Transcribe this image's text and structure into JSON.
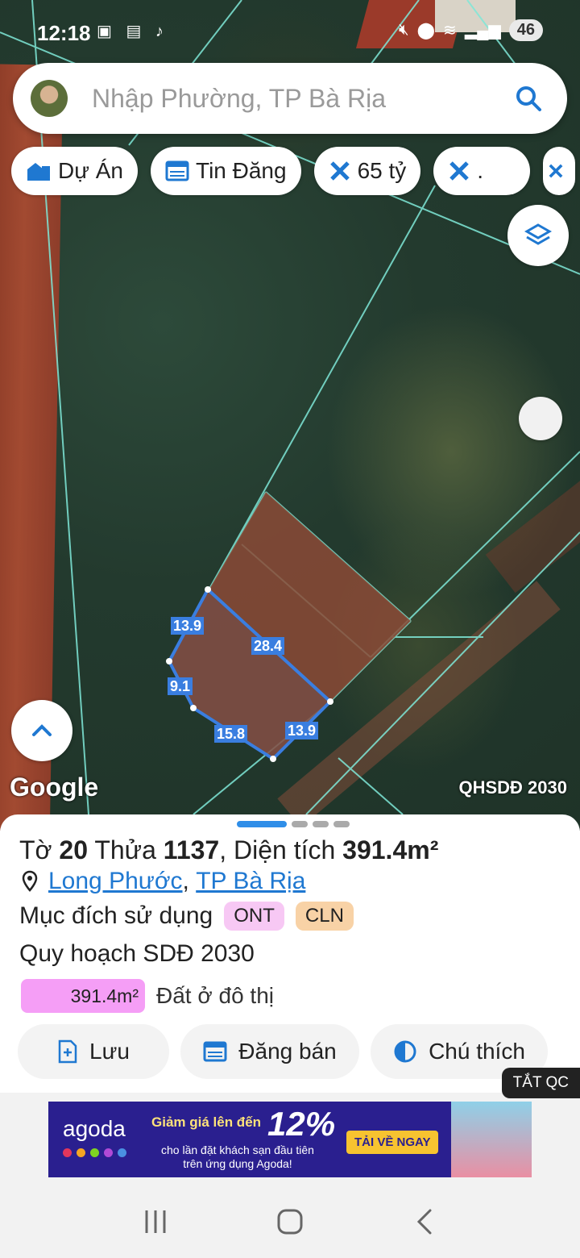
{
  "status_bar": {
    "time": "12:18",
    "battery": "46"
  },
  "search": {
    "placeholder": "Nhập Phường, TP Bà Rịa"
  },
  "filter_chips": [
    {
      "label": "Dự Án",
      "icon": "building-icon"
    },
    {
      "label": "Tin Đăng",
      "icon": "listing-icon"
    },
    {
      "label": "65 tỷ",
      "icon": "ruler-cross-icon"
    },
    {
      "label": ".",
      "icon": "ruler-cross-icon"
    },
    {
      "label": "",
      "icon": "ruler-cross-icon"
    }
  ],
  "map": {
    "attribution": "Google",
    "layer_label": "QHSDĐ 2030",
    "edge_lengths": [
      "13.9",
      "28.4",
      "9.1",
      "15.8",
      "13.9"
    ]
  },
  "parcel": {
    "sheet_prefix": "Tờ",
    "sheet_no": "20",
    "parcel_prefix": "Thửa",
    "parcel_no": "1137",
    "area_prefix": ", Diện tích",
    "area": "391.4m²",
    "ward": "Long Phước",
    "city": "TP Bà Rịa",
    "purpose_label": "Mục đích sử dụng",
    "purpose_tags": [
      "ONT",
      "CLN"
    ],
    "plan_label": "Quy hoạch SDĐ 2030",
    "plan_area": "391.4m²",
    "plan_desc": "Đất ở đô thị"
  },
  "actions": {
    "save": "Lưu",
    "post": "Đăng bán",
    "legend": "Chú thích"
  },
  "ad_close": "TẮT QC",
  "ad": {
    "brand": "agoda",
    "headline": "Giảm giá lên đến",
    "percent": "12%",
    "sub1": "cho lần đặt khách sạn đầu tiên",
    "sub2": "trên ứng dụng Agoda!",
    "cta": "TẢI VỀ NGAY"
  },
  "colors": {
    "accent": "#2f8ee8",
    "plot_line": "#3a7ee0",
    "ont_tag": "#f7c8f4",
    "cln_tag": "#f8d2a6",
    "plan_fill": "#f59ef6"
  }
}
